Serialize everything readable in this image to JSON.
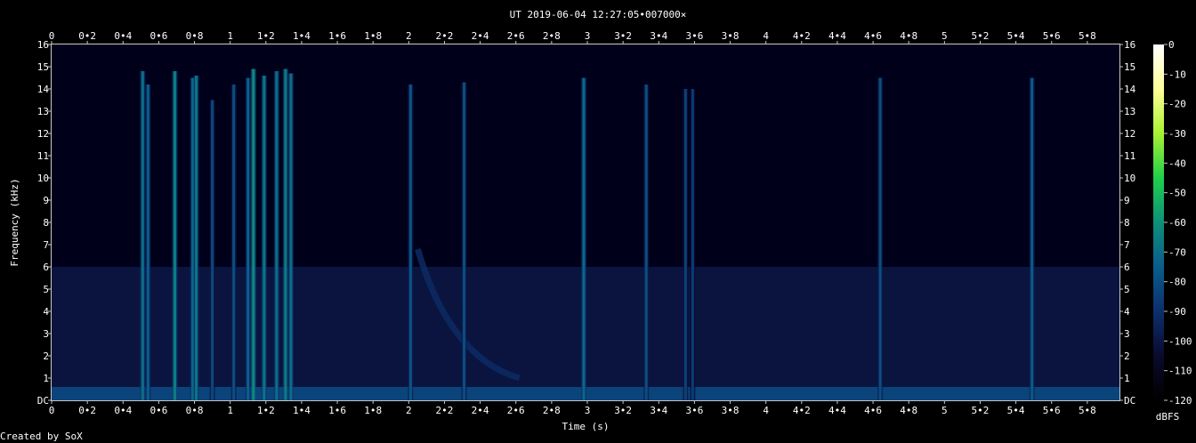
{
  "chart_data": {
    "type": "heatmap",
    "title": "UT 2019-06-04 12:27:05•007000×",
    "xlabel": "Time (s)",
    "ylabel": "Frequency (kHz)",
    "xlim": [
      0,
      5.98
    ],
    "ylim": [
      0,
      16
    ],
    "x_ticks": [
      {
        "v": 0,
        "label": "0"
      },
      {
        "v": 0.2,
        "label": "0•2"
      },
      {
        "v": 0.4,
        "label": "0•4"
      },
      {
        "v": 0.6,
        "label": "0•6"
      },
      {
        "v": 0.8,
        "label": "0•8"
      },
      {
        "v": 1,
        "label": "1"
      },
      {
        "v": 1.2,
        "label": "1•2"
      },
      {
        "v": 1.4,
        "label": "1•4"
      },
      {
        "v": 1.6,
        "label": "1•6"
      },
      {
        "v": 1.8,
        "label": "1•8"
      },
      {
        "v": 2,
        "label": "2"
      },
      {
        "v": 2.2,
        "label": "2•2"
      },
      {
        "v": 2.4,
        "label": "2•4"
      },
      {
        "v": 2.6,
        "label": "2•6"
      },
      {
        "v": 2.8,
        "label": "2•8"
      },
      {
        "v": 3,
        "label": "3"
      },
      {
        "v": 3.2,
        "label": "3•2"
      },
      {
        "v": 3.4,
        "label": "3•4"
      },
      {
        "v": 3.6,
        "label": "3•6"
      },
      {
        "v": 3.8,
        "label": "3•8"
      },
      {
        "v": 4,
        "label": "4"
      },
      {
        "v": 4.2,
        "label": "4•2"
      },
      {
        "v": 4.4,
        "label": "4•4"
      },
      {
        "v": 4.6,
        "label": "4•6"
      },
      {
        "v": 4.8,
        "label": "4•8"
      },
      {
        "v": 5,
        "label": "5"
      },
      {
        "v": 5.2,
        "label": "5•2"
      },
      {
        "v": 5.4,
        "label": "5•4"
      },
      {
        "v": 5.6,
        "label": "5•6"
      },
      {
        "v": 5.8,
        "label": "5•8"
      }
    ],
    "y_ticks": [
      {
        "v": 0,
        "label": "DC"
      },
      {
        "v": 1,
        "label": "1"
      },
      {
        "v": 2,
        "label": "2"
      },
      {
        "v": 3,
        "label": "3"
      },
      {
        "v": 4,
        "label": "4"
      },
      {
        "v": 5,
        "label": "5"
      },
      {
        "v": 6,
        "label": "6"
      },
      {
        "v": 7,
        "label": "7"
      },
      {
        "v": 8,
        "label": "8"
      },
      {
        "v": 9,
        "label": "9"
      },
      {
        "v": 10,
        "label": "10"
      },
      {
        "v": 11,
        "label": "11"
      },
      {
        "v": 12,
        "label": "12"
      },
      {
        "v": 13,
        "label": "13"
      },
      {
        "v": 14,
        "label": "14"
      },
      {
        "v": 15,
        "label": "15"
      },
      {
        "v": 16,
        "label": "16"
      }
    ],
    "colorbar": {
      "label": "dBFS",
      "ticks": [
        "0",
        "-10",
        "-20",
        "-30",
        "-40",
        "-50",
        "-60",
        "-70",
        "-80",
        "-90",
        "-100",
        "-110",
        "-120"
      ],
      "range": [
        -120,
        0
      ],
      "colors": [
        "#000000",
        "#0a0a2e",
        "#0c2f6c",
        "#0a5d8a",
        "#0f8f7a",
        "#1fd04a",
        "#a9f231",
        "#ffff99",
        "#ffffff"
      ]
    },
    "transients": [
      {
        "t": 0.51,
        "fmax": 14.8,
        "level": -70
      },
      {
        "t": 0.54,
        "fmax": 14.2,
        "level": -75
      },
      {
        "t": 0.69,
        "fmax": 14.8,
        "level": -65
      },
      {
        "t": 0.79,
        "fmax": 14.5,
        "level": -72
      },
      {
        "t": 0.81,
        "fmax": 14.6,
        "level": -68
      },
      {
        "t": 0.9,
        "fmax": 13.5,
        "level": -82
      },
      {
        "t": 1.02,
        "fmax": 14.2,
        "level": -80
      },
      {
        "t": 1.1,
        "fmax": 14.5,
        "level": -74
      },
      {
        "t": 1.13,
        "fmax": 14.9,
        "level": -62
      },
      {
        "t": 1.19,
        "fmax": 14.6,
        "level": -68
      },
      {
        "t": 1.26,
        "fmax": 14.8,
        "level": -70
      },
      {
        "t": 1.31,
        "fmax": 14.9,
        "level": -66
      },
      {
        "t": 1.34,
        "fmax": 14.7,
        "level": -70
      },
      {
        "t": 2.01,
        "fmax": 14.2,
        "level": -78
      },
      {
        "t": 2.31,
        "fmax": 14.3,
        "level": -80
      },
      {
        "t": 2.98,
        "fmax": 14.5,
        "level": -72
      },
      {
        "t": 3.33,
        "fmax": 14.2,
        "level": -80
      },
      {
        "t": 3.55,
        "fmax": 14.0,
        "level": -84
      },
      {
        "t": 3.59,
        "fmax": 14.0,
        "level": -86
      },
      {
        "t": 4.64,
        "fmax": 14.5,
        "level": -80
      },
      {
        "t": 5.49,
        "fmax": 14.5,
        "level": -76
      }
    ],
    "sweep": {
      "t_start": 2.05,
      "f_start": 6.8,
      "t_end": 2.62,
      "f_end": 1.0
    },
    "noise_floor": -105
  },
  "footer": {
    "credit": "Created by SoX"
  }
}
